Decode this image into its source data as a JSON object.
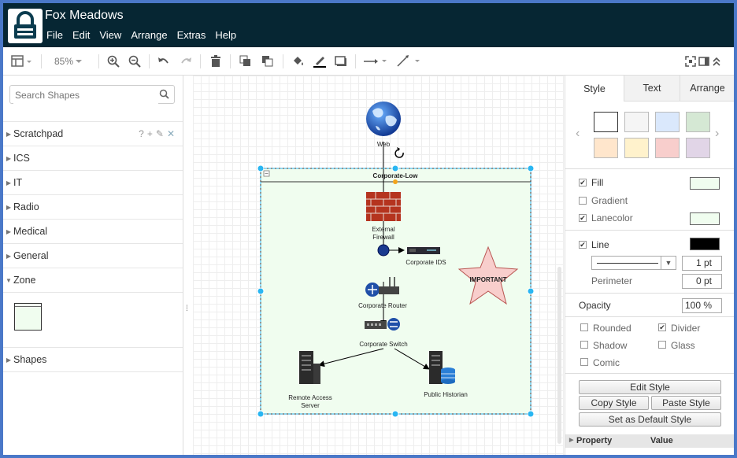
{
  "app": {
    "title": "Fox Meadows"
  },
  "menu": [
    "File",
    "Edit",
    "View",
    "Arrange",
    "Extras",
    "Help"
  ],
  "toolbar": {
    "zoom": "85%"
  },
  "sidebar": {
    "search_placeholder": "Search Shapes",
    "libraries": [
      "Scratchpad",
      "ICS",
      "IT",
      "Radio",
      "Medical",
      "General",
      "Zone",
      "Shapes"
    ]
  },
  "diagram": {
    "web_label": "Web",
    "container_label": "Corporate-Low",
    "firewall_label": "External Firewall",
    "ids_label": "Corporate IDS",
    "router_label": "Corporate Router",
    "switch_label": "Corporate Switch",
    "ras_label": "Remote Access Server",
    "historian_label": "Public Historian",
    "star_label": "IMPORTANT",
    "container_fill": "#f0fdef",
    "selection_color": "#29b6f2",
    "star_fill": "#f8cecc"
  },
  "format": {
    "tabs": [
      "Style",
      "Text",
      "Arrange"
    ],
    "swatches": [
      "#ffffff",
      "#f5f5f5",
      "#dae8fc",
      "#d5e8d4",
      "#ffe6cc",
      "#fff2cc",
      "#f8cecc",
      "#e1d5e7"
    ],
    "fill_label": "Fill",
    "gradient_label": "Gradient",
    "lanecolor_label": "Lanecolor",
    "line_label": "Line",
    "line_width": "1 pt",
    "perimeter_label": "Perimeter",
    "perimeter_value": "0 pt",
    "opacity_label": "Opacity",
    "opacity_value": "100 %",
    "rounded_label": "Rounded",
    "divider_label": "Divider",
    "shadow_label": "Shadow",
    "glass_label": "Glass",
    "comic_label": "Comic",
    "edit_style": "Edit Style",
    "copy_style": "Copy Style",
    "paste_style": "Paste Style",
    "set_default_style": "Set as Default Style",
    "property_header": "Property",
    "value_header": "Value",
    "fill_color": "#f0fdef",
    "lane_color": "#f0fdef",
    "line_color": "#000000"
  }
}
